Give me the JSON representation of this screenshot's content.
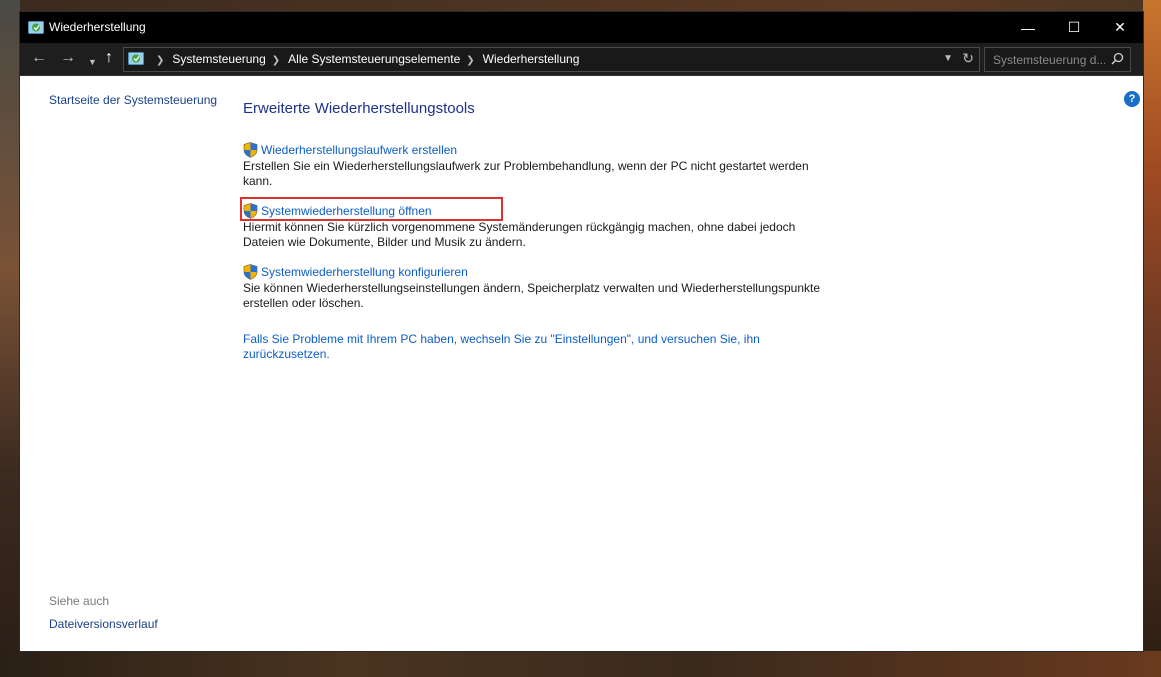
{
  "window": {
    "title": "Wiederherstellung",
    "controls": {
      "minimize": "—",
      "maximize": "☐",
      "close": "✕"
    }
  },
  "address": {
    "breadcrumbs": [
      "Systemsteuerung",
      "Alle Systemsteuerungselemente",
      "Wiederherstellung"
    ],
    "search_placeholder": "Systemsteuerung d..."
  },
  "sidebar": {
    "home_link": "Startseite der Systemsteuerung",
    "see_also_label": "Siehe auch",
    "see_also_link": "Dateiversionsverlauf"
  },
  "main": {
    "title": "Erweiterte Wiederherstellungstools",
    "tools": [
      {
        "link": "Wiederherstellungslaufwerk erstellen",
        "desc": "Erstellen Sie ein Wiederherstellungslaufwerk zur Problembehandlung, wenn der PC nicht gestartet werden kann."
      },
      {
        "link": "Systemwiederherstellung öffnen",
        "desc": "Hiermit können Sie kürzlich vorgenommene Systemänderungen rückgängig machen, ohne dabei jedoch Dateien wie Dokumente, Bilder und Musik zu ändern."
      },
      {
        "link": "Systemwiederherstellung konfigurieren",
        "desc": "Sie können Wiederherstellungseinstellungen ändern, Speicherplatz verwalten und Wiederherstellungspunkte erstellen oder löschen."
      }
    ],
    "settings_link": "Falls Sie Probleme mit Ihrem PC haben, wechseln Sie zu \"Einstellungen\", und versuchen Sie, ihn zurückzusetzen."
  },
  "colors": {
    "link": "#0b5ec9",
    "title": "#1e3287",
    "highlight": "#e03131",
    "titlebar": "#000000"
  },
  "icons": {
    "app": "recovery-icon",
    "shield": "uac-shield-icon",
    "help": "help-icon"
  }
}
